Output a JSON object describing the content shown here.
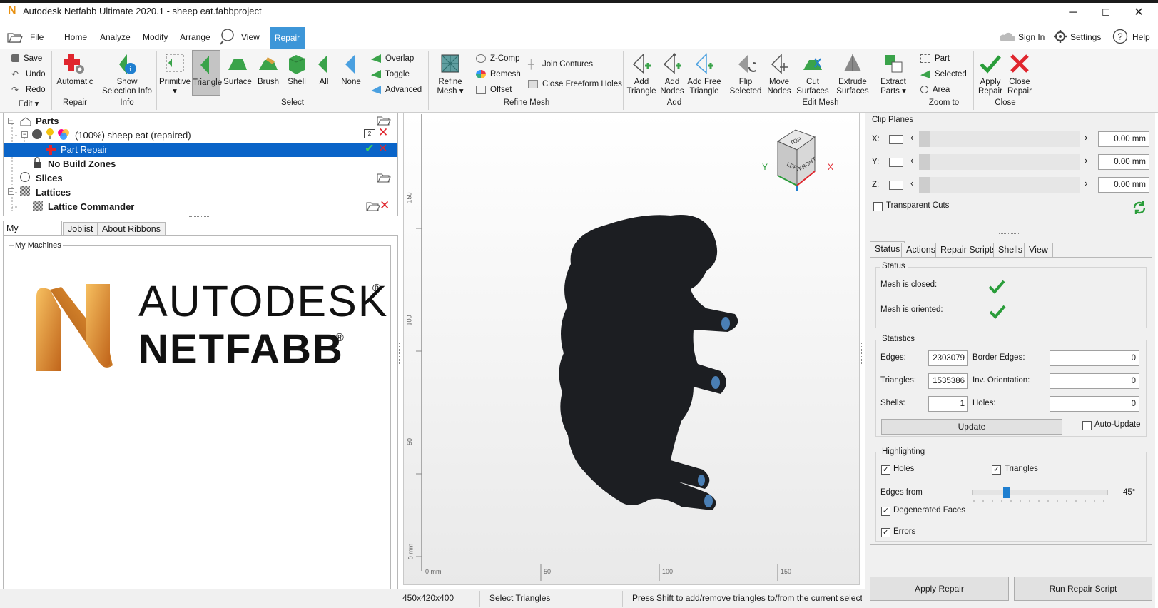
{
  "window": {
    "title": "Autodesk Netfabb Ultimate 2020.1 - sheep eat.fabbproject",
    "minimize": "─",
    "maximize": "☐",
    "close": "✕"
  },
  "menu": {
    "file": "File",
    "home": "Home",
    "analyze": "Analyze",
    "modify": "Modify",
    "arrange": "Arrange",
    "view": "View",
    "repair": "Repair",
    "sign_in": "Sign In",
    "settings": "Settings",
    "help": "Help"
  },
  "ribbon": {
    "edit": {
      "save": "Save",
      "undo": "Undo",
      "redo": "Redo",
      "label": "Edit ▾"
    },
    "repair": {
      "automatic": "Automatic",
      "label": "Repair"
    },
    "info": {
      "show_selection_info_1": "Show",
      "show_selection_info_2": "Selection Info",
      "label": "Info"
    },
    "select": {
      "primitive": "Primitive",
      "triangle": "Triangle",
      "surface": "Surface",
      "brush": "Brush",
      "shell": "Shell",
      "all": "All",
      "none": "None",
      "overlap": "Overlap",
      "toggle": "Toggle",
      "advanced": "Advanced",
      "label": "Select"
    },
    "refine": {
      "refine_mesh_1": "Refine",
      "refine_mesh_2": "Mesh ▾",
      "zcomp": "Z-Comp",
      "remesh": "Remesh",
      "offset": "Offset",
      "join_contures": "Join Contures",
      "close_freeform_holes": "Close Freeform Holes",
      "label": "Refine Mesh"
    },
    "add": {
      "add_triangle_1": "Add",
      "add_triangle_2": "Triangle",
      "add_nodes_1": "Add",
      "add_nodes_2": "Nodes",
      "add_free_1": "Add Free",
      "add_free_2": "Triangle",
      "label": "Add"
    },
    "edit_mesh": {
      "flip_1": "Flip",
      "flip_2": "Selected",
      "move_1": "Move",
      "move_2": "Nodes",
      "cut_1": "Cut",
      "cut_2": "Surfaces",
      "extrude_1": "Extrude",
      "extrude_2": "Surfaces",
      "extract_1": "Extract",
      "extract_2": "Parts ▾",
      "label": "Edit Mesh"
    },
    "zoom": {
      "part": "Part",
      "selected": "Selected",
      "area": "Area",
      "label": "Zoom to"
    },
    "close": {
      "apply_1": "Apply",
      "apply_2": "Repair",
      "close_1": "Close",
      "close_2": "Repair",
      "label": "Close"
    }
  },
  "tree": {
    "parts": "Parts",
    "part_item": "(100%) sheep eat (repaired)",
    "part_badge": "2",
    "part_repair": "Part Repair",
    "no_build_zones": "No Build Zones",
    "slices": "Slices",
    "lattices": "Lattices",
    "lattice_commander": "Lattice Commander"
  },
  "left_tabs": {
    "my_machines": "My Machines",
    "joblist": "Joblist",
    "about_ribbons": "About Ribbons"
  },
  "machines": {
    "group_label": "My Machines",
    "logo_line1": "AUTODESK",
    "logo_line2": "NETFABB",
    "reg": "®"
  },
  "viewport": {
    "ruler_y": [
      "150",
      "100",
      "50",
      "0 mm"
    ],
    "ruler_x": [
      "0 mm",
      "50",
      "100",
      "150"
    ],
    "cube": {
      "top": "TOP",
      "left": "LEFT",
      "front": "FRONT",
      "x": "X",
      "y": "Y"
    }
  },
  "clip_planes": {
    "label": "Clip Planes",
    "x_label": "X:",
    "y_label": "Y:",
    "z_label": "Z:",
    "x_val": "0.00 mm",
    "y_val": "0.00 mm",
    "z_val": "0.00 mm",
    "transparent_cuts": "Transparent Cuts"
  },
  "right_tabs": {
    "status": "Status",
    "actions": "Actions",
    "repair_scripts": "Repair Scripts",
    "shells": "Shells",
    "view": "View"
  },
  "status_group": {
    "label": "Status",
    "closed": "Mesh is closed:",
    "oriented": "Mesh is oriented:"
  },
  "statistics": {
    "label": "Statistics",
    "edges_label": "Edges:",
    "edges": "2303079",
    "border_edges_label": "Border Edges:",
    "border_edges": "0",
    "triangles_label": "Triangles:",
    "triangles": "1535386",
    "inv_orientation_label": "Inv. Orientation:",
    "inv_orientation": "0",
    "shells_label": "Shells:",
    "shells": "1",
    "holes_label": "Holes:",
    "holes": "0",
    "update": "Update",
    "auto_update": "Auto-Update"
  },
  "highlighting": {
    "label": "Highlighting",
    "holes": "Holes",
    "triangles": "Triangles",
    "edges_from": "Edges from",
    "edges_deg": "45°",
    "edges_slider_value": 45,
    "degenerated_faces": "Degenerated Faces",
    "errors": "Errors"
  },
  "bottom_buttons": {
    "apply_repair": "Apply Repair",
    "run_repair_script": "Run Repair Script"
  },
  "statusbar": {
    "dims": "450x420x400",
    "mode": "Select Triangles",
    "hint": "Press Shift to add/remove triangles to/from the current selecti"
  },
  "colors": {
    "accent": "#3d96d8",
    "selection": "#0a64c8",
    "ok_green": "#2a9d3a",
    "error_red": "#e0262e",
    "logo_orange": "#e8900f"
  }
}
